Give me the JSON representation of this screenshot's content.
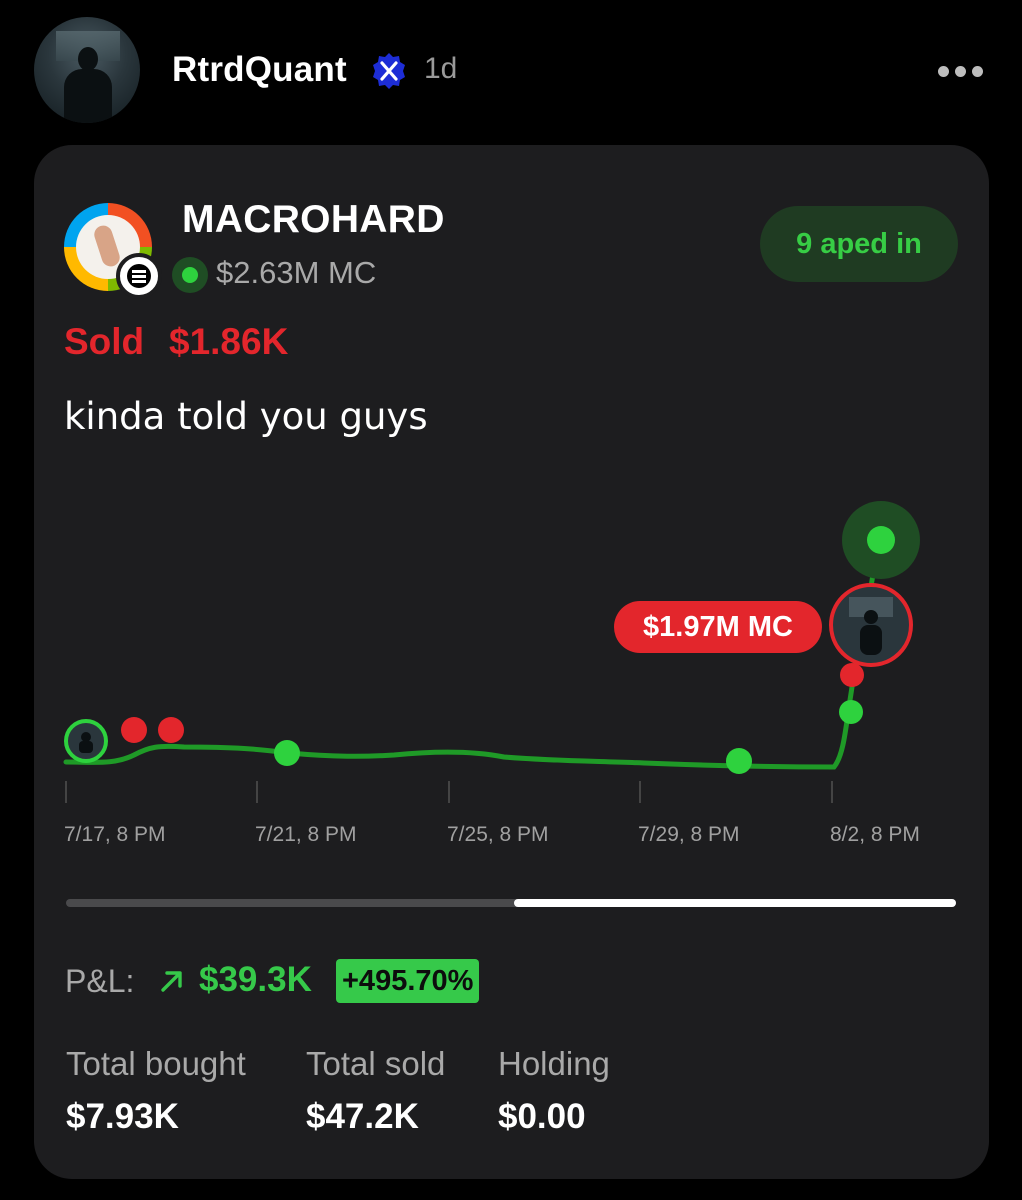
{
  "post": {
    "username": "RtrdQuant",
    "verified_icon": "x-logo-badge-icon",
    "time_ago": "1d",
    "more_icon": "more-horizontal-icon"
  },
  "token": {
    "name": "MACROHARD",
    "market_cap": "$2.63M MC",
    "aped_in": "9 aped in",
    "logo_icon": "macrohard-logo-icon",
    "chain_icon": "solana-icon"
  },
  "trade": {
    "sold_label": "Sold",
    "sold_amount": "$1.86K",
    "caption": "kinda told you guys"
  },
  "chart_data": {
    "type": "line",
    "x_ticks": [
      "7/17, 8 PM",
      "7/21, 8 PM",
      "7/25, 8 PM",
      "7/29, 8 PM",
      "8/2, 8 PM"
    ],
    "annotation": "$1.97M MC",
    "colors": {
      "line": "#1f9a27",
      "buy": "#2ed23e",
      "sell": "#e3262c"
    }
  },
  "pnl": {
    "label": "P&L:",
    "value": "$39.3K",
    "percent": "+495.70%",
    "arrow_icon": "arrow-up-right-icon"
  },
  "stats": {
    "total_bought_label": "Total bought",
    "total_bought": "$7.93K",
    "total_sold_label": "Total sold",
    "total_sold": "$47.2K",
    "holding_label": "Holding",
    "holding": "$0.00"
  }
}
